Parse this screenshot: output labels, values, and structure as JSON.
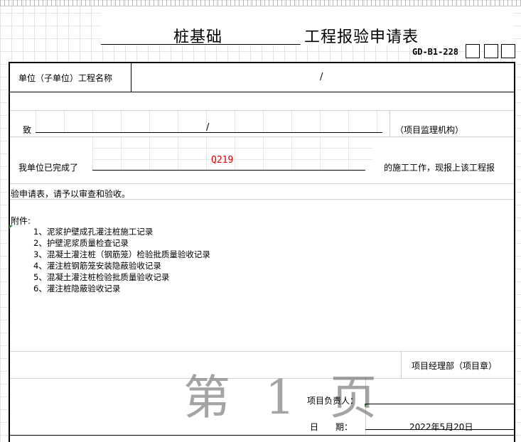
{
  "header": {
    "title_project": "桩基础",
    "title_form": "工程报验申请表",
    "form_code": "GD-B1-228"
  },
  "unit_row": {
    "label": "单位（子单位）工程名称",
    "value": "/"
  },
  "to_row": {
    "label": "致",
    "value": "/",
    "suffix": "（项目监理机构）"
  },
  "completed_row": {
    "prefix": "我单位已完成了",
    "value": "Q219",
    "suffix": "的施工工作，现报上该工程报",
    "continuation": "验申请表，请予以审查和验收。"
  },
  "attachments": {
    "label": "附件:",
    "items": [
      "1、泥浆护壁成孔灌注桩施工记录",
      "2、护壁泥浆质量检查记录",
      "3、混凝土灌注桩（钢筋笼）检验批质量验收记录",
      "4、灌注桩钢筋笼安装隐蔽验收记录",
      "5、混凝土灌注桩检验批质量验收记录",
      "6、灌注桩隐蔽验收记录"
    ]
  },
  "signature": {
    "dept": "项目经理部（项目章）",
    "leader_label": "项目负责人：",
    "date_label": "日　　期：",
    "date_value": "2022年5月20日"
  },
  "watermark": "第 1 页"
}
